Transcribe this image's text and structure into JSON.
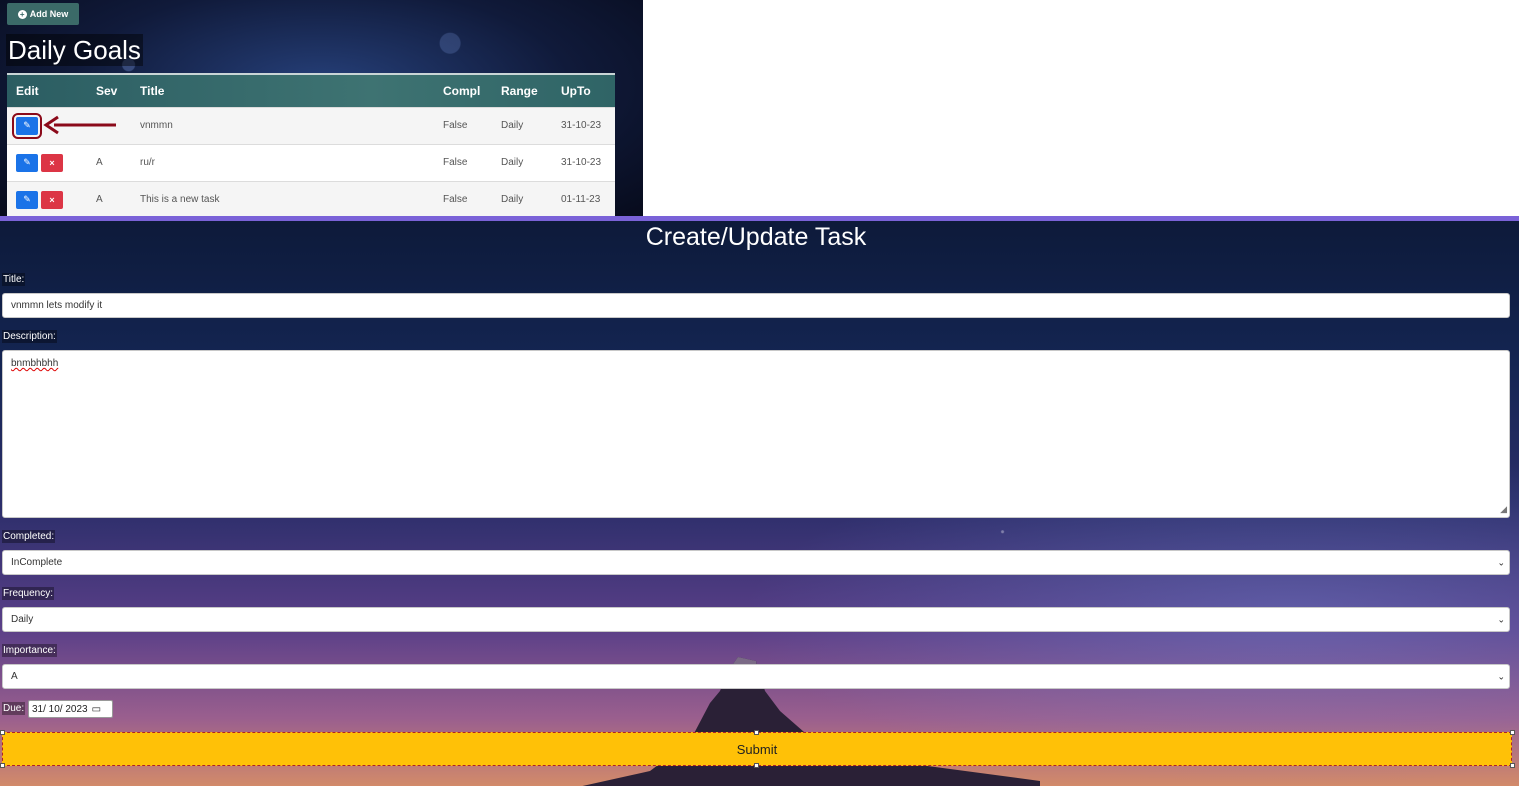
{
  "top": {
    "add_new_label": "Add New",
    "page_title": "Daily Goals",
    "table": {
      "headers": [
        "Edit",
        "Sev",
        "Title",
        "Compl",
        "Range",
        "UpTo"
      ],
      "rows": [
        {
          "sev": "",
          "title": "vnmmn",
          "compl": "False",
          "range": "Daily",
          "upto": "31-10-23"
        },
        {
          "sev": "A",
          "title": "ru/r",
          "compl": "False",
          "range": "Daily",
          "upto": "31-10-23"
        },
        {
          "sev": "A",
          "title": "This is a new task",
          "compl": "False",
          "range": "Daily",
          "upto": "01-11-23"
        }
      ]
    }
  },
  "form": {
    "title": "Create/Update Task",
    "title_label": "Title:",
    "title_value": "vnmmn lets modify it",
    "description_label": "Description:",
    "description_value": "bnmbhbhh",
    "completed_label": "Completed:",
    "completed_value": "InComplete",
    "frequency_label": "Frequency:",
    "frequency_value": "Daily",
    "importance_label": "Importance:",
    "importance_value": "A",
    "due_label": "Due:",
    "due_value": "31/ 10/ 2023",
    "submit_label": "Submit"
  },
  "colors": {
    "accent_teal": "#3b6a68",
    "edit_blue": "#1a73e8",
    "delete_red": "#dc3545",
    "submit_yellow": "#ffc107",
    "annotation_red": "#8b0a1a"
  },
  "icons": {
    "add": "plus-circle-icon",
    "edit": "pencil-icon",
    "delete": "x-icon",
    "calendar": "calendar-icon",
    "select": "chevron-down-icon"
  }
}
